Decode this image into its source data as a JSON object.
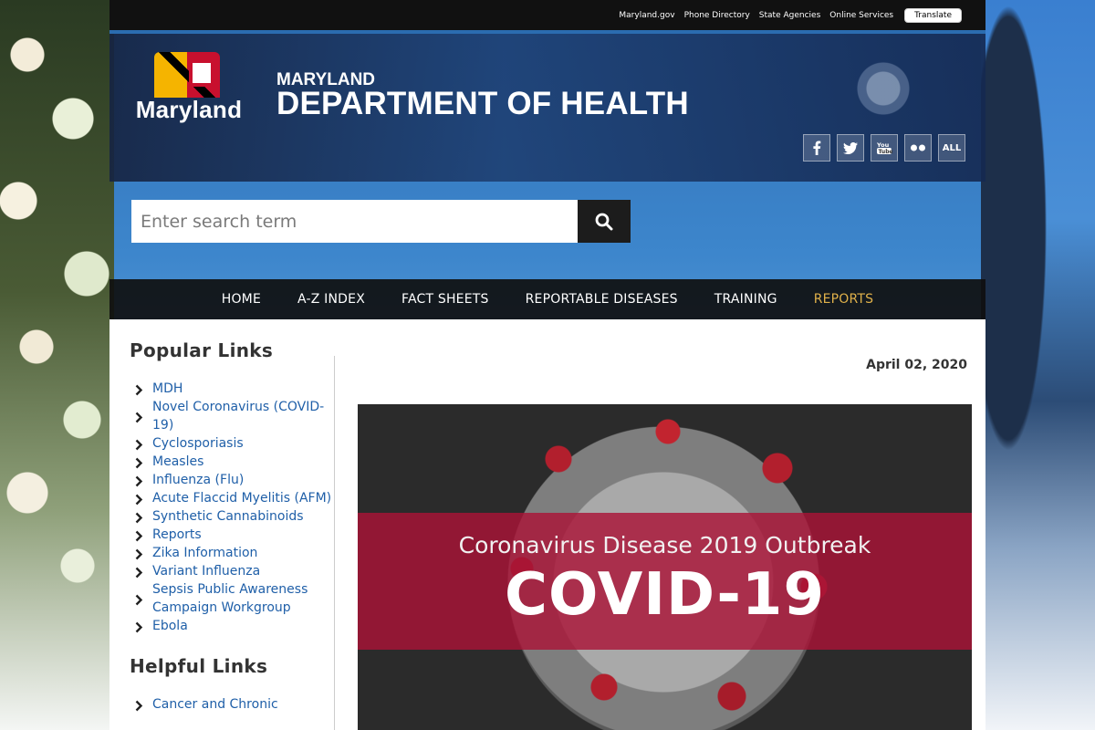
{
  "utility": {
    "links": [
      "Maryland.gov",
      "Phone Directory",
      "State Agencies",
      "Online Services"
    ],
    "translate_label": "Translate"
  },
  "header": {
    "logo_text": "Maryland",
    "title_small": "MARYLAND",
    "title_big": "DEPARTMENT OF HEALTH",
    "socials": [
      "facebook-icon",
      "twitter-icon",
      "youtube-icon",
      "flickr-icon",
      "ALL"
    ]
  },
  "search": {
    "placeholder": "Enter search term"
  },
  "nav": {
    "items": [
      "HOME",
      "A-Z INDEX",
      "FACT SHEETS",
      "REPORTABLE DISEASES",
      "TRAINING",
      "REPORTS"
    ],
    "active": "REPORTS",
    "active_color": "#e0b14a"
  },
  "sidebar": {
    "popular_title": "Popular Links",
    "popular_links": [
      "MDH",
      "Novel Coronavirus (COVID-19)",
      "Cyclosporiasis",
      "Measles",
      "Influenza (Flu)",
      "Acute Flaccid Myelitis (AFM)",
      "Synthetic Cannabinoids",
      "Reports",
      "Zika Information",
      "Variant Influenza",
      "Sepsis Public Awareness Campaign Workgroup",
      "Ebola"
    ],
    "helpful_title": "Helpful Links",
    "helpful_links": [
      "Cancer and Chronic"
    ]
  },
  "main": {
    "date": "April 02, 2020",
    "hero_subtitle": "Coronavirus Disease 2019 Outbreak",
    "hero_headline": "COVID-19"
  },
  "colors": {
    "link": "#1f5fa8",
    "header_rule": "#2b6cb0",
    "hero_band": "#aa1437"
  }
}
